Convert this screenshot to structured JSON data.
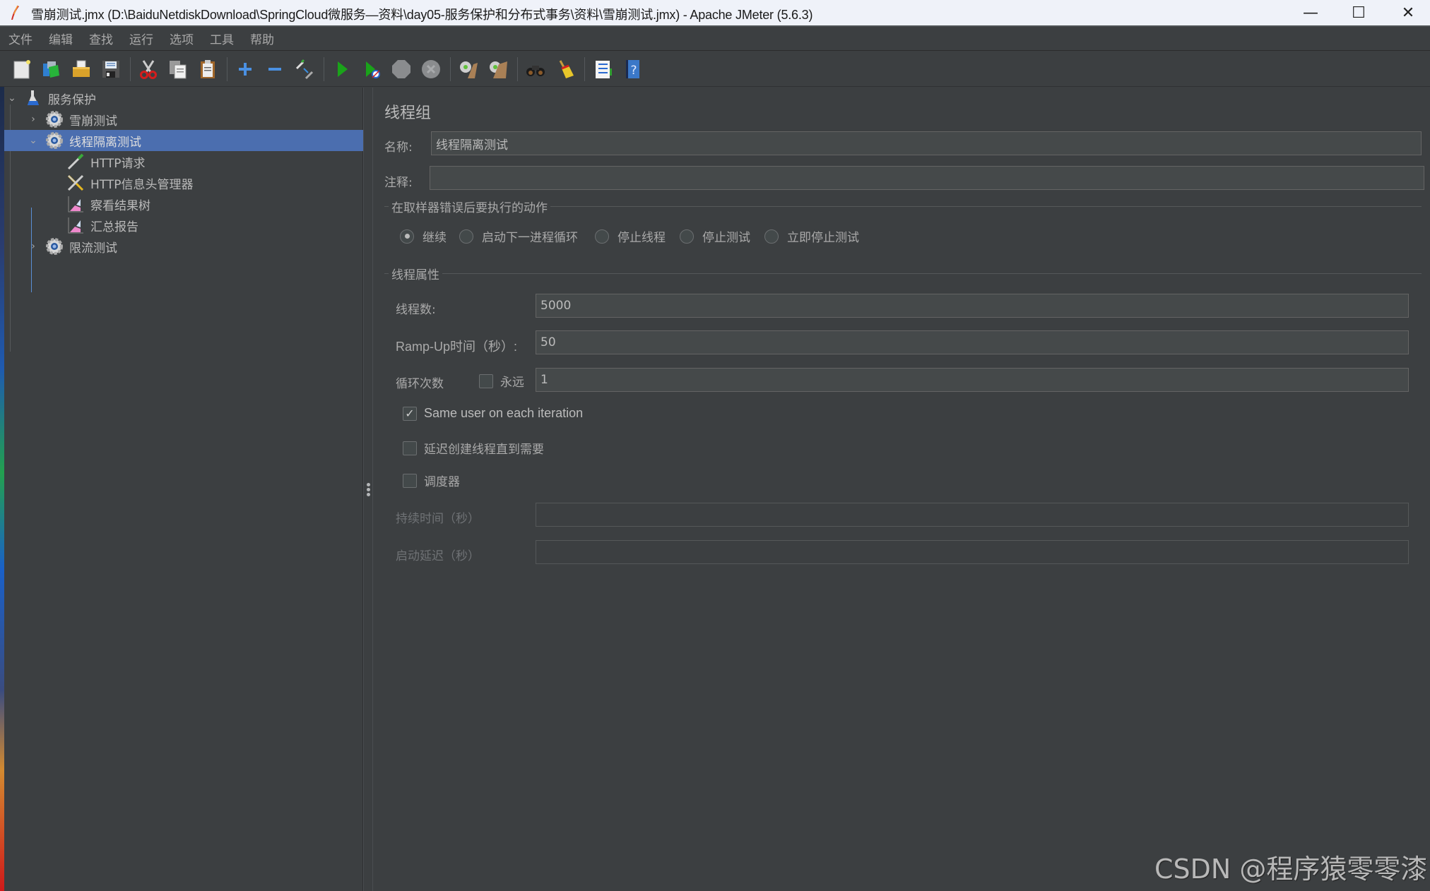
{
  "window": {
    "title": "雪崩测试.jmx (D:\\BaiduNetdiskDownload\\SpringCloud微服务—资料\\day05-服务保护和分布式事务\\资料\\雪崩测试.jmx) - Apache JMeter (5.6.3)",
    "minimize_glyph": "—",
    "maximize_glyph": "☐",
    "close_glyph": "✕"
  },
  "menu": [
    "文件",
    "编辑",
    "查找",
    "运行",
    "选项",
    "工具",
    "帮助"
  ],
  "toolbar": {
    "groups": [
      [
        {
          "name": "new",
          "icon": "new-file-icon"
        },
        {
          "name": "templates",
          "icon": "templates-icon"
        },
        {
          "name": "open",
          "icon": "open-folder-icon"
        },
        {
          "name": "save",
          "icon": "save-disk-icon"
        }
      ],
      [
        {
          "name": "cut",
          "icon": "scissors-icon"
        },
        {
          "name": "copy",
          "icon": "copy-icon"
        },
        {
          "name": "paste",
          "icon": "paste-clipboard-icon"
        }
      ],
      [
        {
          "name": "expand",
          "icon": "plus-icon"
        },
        {
          "name": "collapse",
          "icon": "minus-icon"
        },
        {
          "name": "toggle",
          "icon": "toggle-pipette-icon"
        }
      ],
      [
        {
          "name": "start",
          "icon": "play-icon"
        },
        {
          "name": "start-no-pauses",
          "icon": "play-no-timer-icon"
        },
        {
          "name": "stop",
          "icon": "stop-icon"
        },
        {
          "name": "shutdown",
          "icon": "shutdown-icon"
        }
      ],
      [
        {
          "name": "clear",
          "icon": "clear-gear-broom-icon"
        },
        {
          "name": "clear-all",
          "icon": "clear-all-gear-broom-icon"
        }
      ],
      [
        {
          "name": "search",
          "icon": "binoculars-icon"
        },
        {
          "name": "reset-search",
          "icon": "broom-icon"
        }
      ],
      [
        {
          "name": "function-helper",
          "icon": "function-list-icon"
        },
        {
          "name": "help",
          "icon": "help-book-icon"
        }
      ]
    ]
  },
  "tree": {
    "items": [
      {
        "label": "服务保护",
        "icon": "test-plan-flask-icon",
        "level": 0,
        "expander": "expanded"
      },
      {
        "label": "雪崩测试",
        "icon": "thread-group-gear-icon",
        "level": 1,
        "expander": "collapsed"
      },
      {
        "label": "线程隔离测试",
        "icon": "thread-group-gear-icon",
        "level": 1,
        "expander": "expanded",
        "selected": true
      },
      {
        "label": "HTTP请求",
        "icon": "http-sampler-pipette-icon",
        "level": 2
      },
      {
        "label": "HTTP信息头管理器",
        "icon": "header-manager-tools-icon",
        "level": 2
      },
      {
        "label": "察看结果树",
        "icon": "listener-graph-icon",
        "level": 2
      },
      {
        "label": "汇总报告",
        "icon": "listener-graph-icon",
        "level": 2
      },
      {
        "label": "限流测试",
        "icon": "thread-group-gear-icon",
        "level": 1,
        "expander": "collapsed"
      }
    ]
  },
  "panel": {
    "title": "线程组",
    "name_label": "名称:",
    "name_value": "线程隔离测试",
    "comment_label": "注释:",
    "comment_value": "",
    "error_action": {
      "title": "在取样器错误后要执行的动作",
      "options": [
        {
          "label": "继续",
          "selected": true
        },
        {
          "label": "启动下一进程循环",
          "selected": false
        },
        {
          "label": "停止线程",
          "selected": false
        },
        {
          "label": "停止测试",
          "selected": false
        },
        {
          "label": "立即停止测试",
          "selected": false
        }
      ]
    },
    "thread_props": {
      "title": "线程属性",
      "threads_label": "线程数:",
      "threads_value": "5000",
      "rampup_label": "Ramp-Up时间（秒）:",
      "rampup_value": "50",
      "loop_label": "循环次数",
      "forever_label": "永远",
      "forever_checked": false,
      "loop_value": "1",
      "same_user_label": "Same user on each iteration",
      "same_user_checked": true,
      "delay_create_label": "延迟创建线程直到需要",
      "delay_create_checked": false,
      "scheduler_label": "调度器",
      "scheduler_checked": false,
      "duration_label": "持续时间（秒）",
      "duration_value": "",
      "startup_delay_label": "启动延迟（秒）",
      "startup_delay_value": ""
    }
  },
  "watermark": "CSDN @程序猿零零漆",
  "colors": {
    "background": "#3c3f41",
    "selection": "#4b6eaf",
    "field_bg": "#45494a",
    "field_border": "#646464",
    "text": "#bbbbbb",
    "titlebar": "#eff2f9"
  }
}
